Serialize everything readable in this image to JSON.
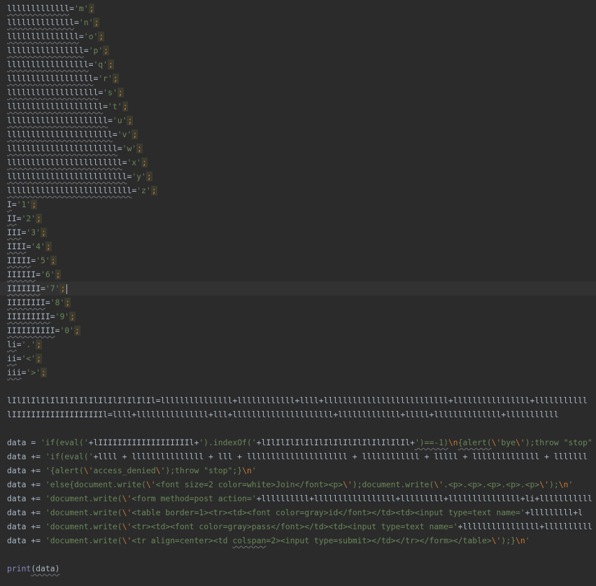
{
  "colors": {
    "background": "#2b2b2b",
    "text": "#a9b7c6",
    "string": "#6a8759",
    "keyword_escape": "#cc7832",
    "current_line": "#323232"
  },
  "lines": {
    "l01": {
      "var": "lllllllllllll",
      "val": "'m'"
    },
    "l02": {
      "var": "llllllllllllll",
      "val": "'n'"
    },
    "l03": {
      "var": "lllllllllllllll",
      "val": "'o'"
    },
    "l04": {
      "var": "llllllllllllllll",
      "val": "'p'"
    },
    "l05": {
      "var": "lllllllllllllllll",
      "val": "'q'"
    },
    "l06": {
      "var": "llllllllllllllllll",
      "val": "'r'"
    },
    "l07": {
      "var": "lllllllllllllllllll",
      "val": "'s'"
    },
    "l08": {
      "var": "llllllllllllllllllll",
      "val": "'t'"
    },
    "l09": {
      "var": "lllllllllllllllllllll",
      "val": "'u'"
    },
    "l10": {
      "var": "llllllllllllllllllllll",
      "val": "'v'"
    },
    "l11": {
      "var": "lllllllllllllllllllllll",
      "val": "'w'"
    },
    "l12": {
      "var": "llllllllllllllllllllllll",
      "val": "'x'"
    },
    "l13": {
      "var": "lllllllllllllllllllllllll",
      "val": "'y'"
    },
    "l14": {
      "var": "llllllllllllllllllllllllll",
      "val": "'z'"
    },
    "l15": {
      "var": "I",
      "val": "'1'"
    },
    "l16": {
      "var": "II",
      "val": "'2'"
    },
    "l17": {
      "var": "III",
      "val": "'3'"
    },
    "l18": {
      "var": "IIII",
      "val": "'4'"
    },
    "l19": {
      "var": "IIIII",
      "val": "'5'"
    },
    "l20": {
      "var": "IIIIII",
      "val": "'6'"
    },
    "l21": {
      "var": "IIIIIII",
      "val": "'7'"
    },
    "l22": {
      "var": "IIIIIIII",
      "val": "'8'"
    },
    "l23": {
      "var": "IIIIIIIII",
      "val": "'9'"
    },
    "l24": {
      "var": "IIIIIIIIII",
      "val": "'0'"
    },
    "l25": {
      "var": "li",
      "val": "'.'"
    },
    "l26": {
      "var": "ii",
      "val": "'<'"
    },
    "l27": {
      "var": "iii",
      "val": "'>'"
    },
    "eq": "=",
    "semi": ";",
    "l29": "lIlIlIlIlIlIlIlIlIlIlIlIlIlIlIl=lllllllllllllll+llllllllllll+llll+llllllllllllllllllllllllll+llllllllllllllll+lllllllllll",
    "l30": "lIIIIIIIIIIIIIIIIIIIl=llll+lllllllllllllll+lll+lllllllllllllllllllll+lllllllllllll+lllll+llllllllllllll+lllllllllll",
    "d1": {
      "a": "data = ",
      "b": "'if(eval('",
      "c": "+lIIIIIIIIIIIIIIIIIIIl+",
      "d": "').indexOf('",
      "e": "+lIlIlIlIlIlIlIlIlIlIlIlIlIlIlIl+",
      "f": "')==-1)",
      "g": "\\n",
      "h": "{alert(",
      "i": "\\'",
      "j": "bye",
      "k": "\\'",
      "l": ");throw \"stop\""
    },
    "d2": {
      "a": "data += ",
      "b": "'if(eval('",
      "c": "+llll + lllllllllllllll + lll + lllllllllllllllllllll + llllllllllll + lllll + llllllllllllll + lllllll"
    },
    "d3": {
      "a": "data += ",
      "b": "'{alert(",
      "c": "\\'",
      "d": "access_denied",
      "e": "\\'",
      "f": ");throw \"stop\";}",
      "g": "\\n",
      "h": "'"
    },
    "d4": {
      "a": "data += ",
      "b": "'else{document.write(",
      "c": "\\'",
      "d": "<font size=2 color=white>Join</font><p>",
      "e": "\\'",
      "f": ");document.write(",
      "g": "\\'",
      "h": ".<p>.<p>.<p>.<p>.<p>",
      "i": "\\'",
      "j": ");",
      "k": "\\n",
      "l": "'"
    },
    "d5": {
      "a": "data += ",
      "b": "'document.write(",
      "c": "\\'",
      "d": "<form method=post action='",
      "e": "+llllllllll+lllllllllllllllll+lllllllll+lllllllllllllll+li+lllllllllll"
    },
    "d6": {
      "a": "data += ",
      "b": "'document.write(",
      "c": "\\'",
      "d": "<table border=1><tr><td><font color=gray>id</font></td><td><input type=text name='",
      "e": "+lllllllll+l"
    },
    "d7": {
      "a": "data += ",
      "b": "'document.write(",
      "c": "\\'",
      "d": "<tr><td><font color=gray>pass</font></td><td><input type=text name='",
      "e": "+llllllllllllllll+llllllllll"
    },
    "d8": {
      "a": "data += ",
      "b": "'document.write(",
      "c": "\\'",
      "d": "<tr align=center><td ",
      "e": "colspan",
      "f": "=2><input type=submit></td></tr></form></table>",
      "g": "\\'",
      "h": ");}",
      "i": "\\n",
      "j": "'"
    },
    "p1": {
      "fn": "print",
      "arg": "(data)"
    }
  }
}
